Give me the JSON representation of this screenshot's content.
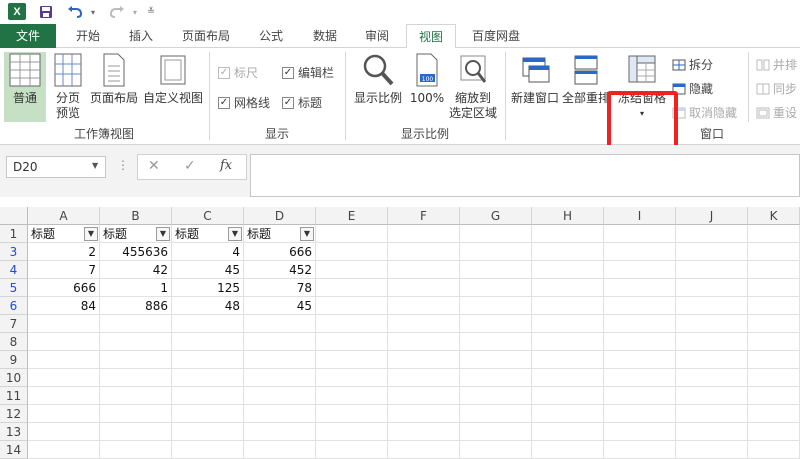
{
  "qat": {
    "logo": "X",
    "icons": [
      "excel-icon",
      "save-icon",
      "undo-icon",
      "redo-icon",
      "customize-icon"
    ]
  },
  "tabs": [
    "文件",
    "开始",
    "插入",
    "页面布局",
    "公式",
    "数据",
    "审阅",
    "视图",
    "百度网盘"
  ],
  "ribbon": {
    "workbook_views": {
      "label": "工作簿视图",
      "normal": "普通",
      "page_break_1": "分页",
      "page_break_2": "预览",
      "page_layout": "页面布局",
      "custom_view": "自定义视图"
    },
    "show": {
      "label": "显示",
      "ruler": "标尺",
      "formula_bar": "编辑栏",
      "gridlines": "网格线",
      "headings": "标题"
    },
    "zoom": {
      "label": "显示比例",
      "zoom": "显示比例",
      "hundred": "100%",
      "zoom_sel_1": "缩放到",
      "zoom_sel_2": "选定区域"
    },
    "window": {
      "label": "窗口",
      "new_window": "新建窗口",
      "arrange_all": "全部重排",
      "freeze": "冻结窗格",
      "split": "拆分",
      "hide": "隐藏",
      "unhide": "取消隐藏",
      "side_by_side": "并排",
      "sync": "同步",
      "reset": "重设"
    }
  },
  "formula_bar": {
    "name_box": "D20",
    "fx": "fx"
  },
  "grid": {
    "columns": [
      "A",
      "B",
      "C",
      "D",
      "E",
      "F",
      "G",
      "H",
      "I",
      "J",
      "K"
    ],
    "rows": [
      "1",
      "3",
      "4",
      "5",
      "6",
      "7",
      "8",
      "9",
      "10",
      "11",
      "12",
      "13",
      "14"
    ],
    "header_row": [
      "标题",
      "标题",
      "标题",
      "标题"
    ],
    "data": [
      [
        "2",
        "455636",
        "4",
        "666"
      ],
      [
        "7",
        "42",
        "45",
        "452"
      ],
      [
        "666",
        "1",
        "125",
        "78"
      ],
      [
        "84",
        "886",
        "48",
        "45"
      ]
    ]
  },
  "colors": {
    "excel_green": "#217346",
    "highlight": "#ee2222",
    "filtered_row": "#1f4ec9"
  }
}
